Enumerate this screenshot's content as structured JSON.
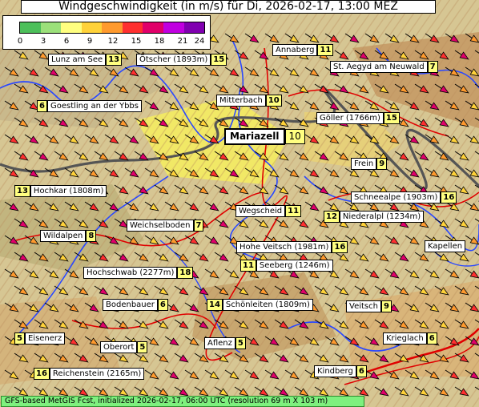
{
  "title": "Windgeschwindigkeit (in m/s) für Di, 2026-02-17, 13:00 MEZ",
  "legend": {
    "ticks": [
      "0",
      "3",
      "6",
      "9",
      "12",
      "15",
      "18",
      "21",
      "24"
    ],
    "colors": [
      "#4cbf5a",
      "#9be07a",
      "#ffff80",
      "#ffd23a",
      "#ff9a2e",
      "#ff3030",
      "#e0006a",
      "#c000e0",
      "#8000b0"
    ]
  },
  "places": [
    {
      "name": "Lunz am See",
      "value": "13"
    },
    {
      "name": "Ötscher (1893m)",
      "value": "15"
    },
    {
      "name": "Annaberg",
      "value": "11"
    },
    {
      "name": "St. Aegyd am Neuwald",
      "value": "7"
    },
    {
      "name": "Goestling an der Ybbs",
      "value": "6"
    },
    {
      "name": "Mitterbach",
      "value": "10"
    },
    {
      "name": "Göller (1766m)",
      "value": "15"
    },
    {
      "name": "Mariazell",
      "value": "10"
    },
    {
      "name": "Frein",
      "value": "9"
    },
    {
      "name": "Hochkar (1808m)",
      "value": "13"
    },
    {
      "name": "Schneealpe (1903m)",
      "value": "16"
    },
    {
      "name": "Wegscheid",
      "value": "11"
    },
    {
      "name": "Niederalpl (1234m)",
      "value": "12"
    },
    {
      "name": "Weichselboden",
      "value": "7"
    },
    {
      "name": "Wildalpen",
      "value": "8"
    },
    {
      "name": "Kapellen",
      "value": ""
    },
    {
      "name": "Hohe Veitsch (1981m)",
      "value": "16"
    },
    {
      "name": "Seeberg (1246m)",
      "value": "11"
    },
    {
      "name": "Hochschwab (2277m)",
      "value": "18"
    },
    {
      "name": "Bodenbauer",
      "value": "6"
    },
    {
      "name": "Schönleiten (1809m)",
      "value": "14"
    },
    {
      "name": "Veitsch",
      "value": "9"
    },
    {
      "name": "Eisenerz",
      "value": "5"
    },
    {
      "name": "Oberort",
      "value": "5"
    },
    {
      "name": "Aflenz",
      "value": "5"
    },
    {
      "name": "Krieglach",
      "value": "6"
    },
    {
      "name": "Reichenstein (2165m)",
      "value": "16"
    },
    {
      "name": "Kindberg",
      "value": "6"
    }
  ],
  "footer": "GFS-based MetGIS Fcst, initialized 2026-02-17, 06:00 UTC  (resolution 69 m X 103 m)"
}
